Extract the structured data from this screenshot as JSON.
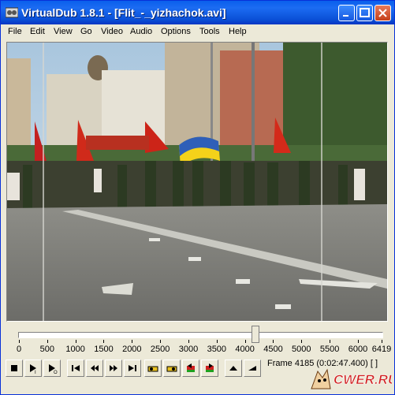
{
  "window": {
    "title": "VirtualDub 1.8.1 - [Flit_-_yizhachok.avi]",
    "buttons": [
      "minimize",
      "maximize",
      "close"
    ]
  },
  "menu": [
    "File",
    "Edit",
    "View",
    "Go",
    "Video",
    "Audio",
    "Options",
    "Tools",
    "Help"
  ],
  "timeline": {
    "ticks": [
      "0",
      "500",
      "1000",
      "1500",
      "2000",
      "2500",
      "3000",
      "3500",
      "4000",
      "4500",
      "5000",
      "5500",
      "6000",
      "6419"
    ],
    "max_frame": 6419,
    "current_frame": 4185
  },
  "toolbar": {
    "buttons": [
      "stop-icon",
      "play-input-icon",
      "play-output-icon",
      "go-start-icon",
      "step-back-icon",
      "step-forward-icon",
      "go-end-icon",
      "prev-keyframe-icon",
      "next-keyframe-icon",
      "scene-back-icon",
      "scene-forward-icon",
      "mark-in-icon",
      "mark-out-icon"
    ],
    "frame_text": "Frame 4185 (0:02:47.400) [ ]"
  },
  "watermark": {
    "text": "CWER.RU"
  },
  "colors": {
    "title_bar": "#0a5fec",
    "window_bg": "#ece9d8",
    "watermark_red": "#d02020"
  }
}
